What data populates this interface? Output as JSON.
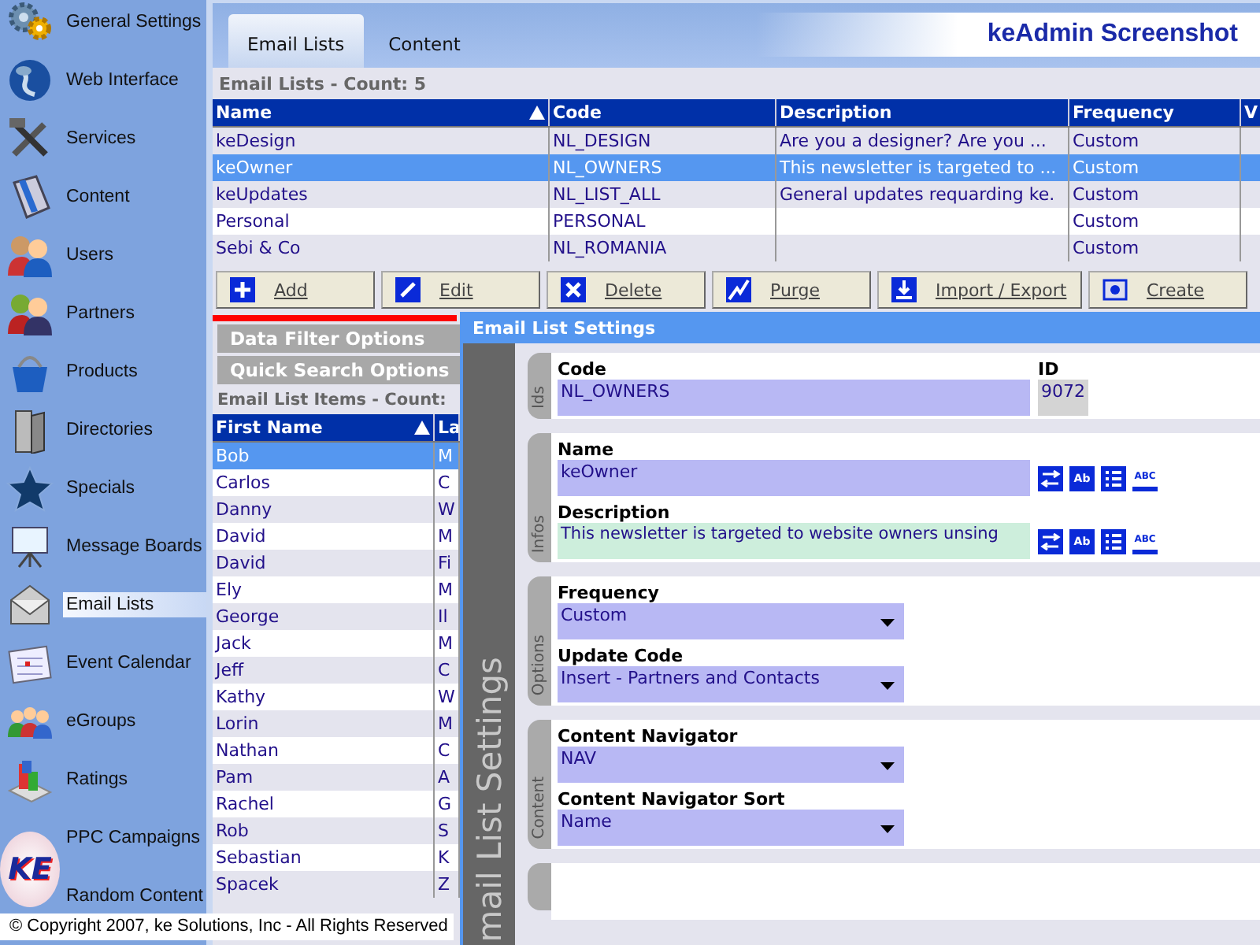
{
  "sidebar": {
    "items": [
      {
        "label": "General Settings",
        "selected": false
      },
      {
        "label": "Web Interface",
        "selected": false
      },
      {
        "label": "Services",
        "selected": false
      },
      {
        "label": "Content",
        "selected": false
      },
      {
        "label": "Users",
        "selected": false
      },
      {
        "label": "Partners",
        "selected": false
      },
      {
        "label": "Products",
        "selected": false
      },
      {
        "label": "Directories",
        "selected": false
      },
      {
        "label": "Specials",
        "selected": false
      },
      {
        "label": "Message Boards",
        "selected": false
      },
      {
        "label": "Email Lists",
        "selected": true
      },
      {
        "label": "Event Calendar",
        "selected": false
      },
      {
        "label": "eGroups",
        "selected": false
      },
      {
        "label": "Ratings",
        "selected": false
      },
      {
        "label": "PPC Campaigns",
        "selected": false
      },
      {
        "label": "Random Content",
        "selected": false
      }
    ],
    "logo": "KE"
  },
  "tabs": [
    {
      "label": "Email Lists",
      "selected": true
    },
    {
      "label": "Content",
      "selected": false
    }
  ],
  "app_title": "keAdmin Screenshot",
  "lists_grid": {
    "caption": "Email Lists - Count: 5",
    "columns": [
      {
        "label": "Name",
        "sorted": true
      },
      {
        "label": "Code",
        "sorted": false
      },
      {
        "label": "Description",
        "sorted": false
      },
      {
        "label": "Frequency",
        "sorted": false
      },
      {
        "label": "V",
        "sorted": false
      }
    ],
    "rows": [
      {
        "cells": [
          "keDesign",
          "NL_DESIGN",
          "Are you a designer? Are you ...",
          "Custom"
        ],
        "selected": false
      },
      {
        "cells": [
          "keOwner",
          "NL_OWNERS",
          "This newsletter is targeted to ...",
          "Custom"
        ],
        "selected": true
      },
      {
        "cells": [
          "keUpdates",
          "NL_LIST_ALL",
          "General updates requarding ke.",
          "Custom"
        ],
        "selected": false
      },
      {
        "cells": [
          "Personal",
          "PERSONAL",
          "",
          "Custom"
        ],
        "selected": false
      },
      {
        "cells": [
          "Sebi & Co",
          "NL_ROMANIA",
          "",
          "Custom"
        ],
        "selected": false
      }
    ]
  },
  "toolbar": [
    {
      "label": "Add",
      "kind": "add"
    },
    {
      "label": "Edit",
      "kind": "edit"
    },
    {
      "label": "Delete",
      "kind": "delete"
    },
    {
      "label": "Purge",
      "kind": "purge"
    },
    {
      "label": "Import / Export",
      "kind": "import"
    },
    {
      "label": "Create",
      "kind": "create"
    }
  ],
  "filter_panels": [
    "Data Filter Options",
    "Quick Search Options"
  ],
  "items_grid": {
    "caption": "Email List Items - Count:",
    "columns": [
      {
        "label": "First Name",
        "sorted": true
      },
      {
        "label": "La"
      }
    ],
    "rows": [
      {
        "cells": [
          "Bob",
          "M"
        ],
        "selected": true
      },
      {
        "cells": [
          "Carlos",
          "C"
        ],
        "selected": false
      },
      {
        "cells": [
          "Danny",
          "W"
        ],
        "selected": false
      },
      {
        "cells": [
          "David",
          "M"
        ],
        "selected": false
      },
      {
        "cells": [
          "David",
          "Fi"
        ],
        "selected": false
      },
      {
        "cells": [
          "Ely",
          "M"
        ],
        "selected": false
      },
      {
        "cells": [
          "George",
          "Il"
        ],
        "selected": false
      },
      {
        "cells": [
          "Jack",
          "M"
        ],
        "selected": false
      },
      {
        "cells": [
          "Jeff",
          "C"
        ],
        "selected": false
      },
      {
        "cells": [
          "Kathy",
          "W"
        ],
        "selected": false
      },
      {
        "cells": [
          "Lorin",
          "M"
        ],
        "selected": false
      },
      {
        "cells": [
          "Nathan",
          "C"
        ],
        "selected": false
      },
      {
        "cells": [
          "Pam",
          "A"
        ],
        "selected": false
      },
      {
        "cells": [
          "Rachel",
          "G"
        ],
        "selected": false
      },
      {
        "cells": [
          "Rob",
          "S"
        ],
        "selected": false
      },
      {
        "cells": [
          "Sebastian",
          "K"
        ],
        "selected": false
      },
      {
        "cells": [
          "Spacek",
          "Z"
        ],
        "selected": false
      }
    ]
  },
  "dialog": {
    "title": "Email List Settings",
    "side_label": "mail List Settings",
    "groups": [
      {
        "kind": "section",
        "label": "Ids",
        "fields": [
          {
            "label": "Code",
            "value": "NL_OWNERS",
            "kind": "text"
          },
          {
            "label": "ID",
            "value": "9072",
            "kind": "readonly"
          }
        ]
      },
      {
        "kind": "section",
        "label": "Infos",
        "fields": [
          {
            "label": "Name",
            "value": "keOwner",
            "kind": "text",
            "tools": [
              {
                "kind": "swap"
              },
              {
                "kind": "format",
                "label": "Ab"
              },
              {
                "kind": "list"
              },
              {
                "kind": "spell",
                "label": "ABC"
              }
            ]
          },
          {
            "label": "Description",
            "value": "This newsletter is targeted to website owners unsing",
            "kind": "memo",
            "tools": [
              {
                "kind": "swap"
              },
              {
                "kind": "format",
                "label": "Ab"
              },
              {
                "kind": "list"
              },
              {
                "kind": "spell",
                "label": "ABC"
              }
            ]
          }
        ]
      },
      {
        "kind": "section",
        "label": "Options",
        "fields": [
          {
            "label": "Frequency",
            "value": "Custom",
            "kind": "select"
          },
          {
            "label": "Update Code",
            "value": "Insert - Partners and Contacts",
            "kind": "select"
          }
        ]
      },
      {
        "kind": "section",
        "label": "Content",
        "fields": [
          {
            "label": "Content Navigator",
            "value": "NAV",
            "kind": "select"
          },
          {
            "label": "Content Navigator Sort",
            "value": "Name",
            "kind": "select"
          }
        ]
      },
      {
        "kind": "partial"
      }
    ]
  },
  "copyright": "© Copyright 2007, ke Solutions, Inc - All Rights Reserved"
}
